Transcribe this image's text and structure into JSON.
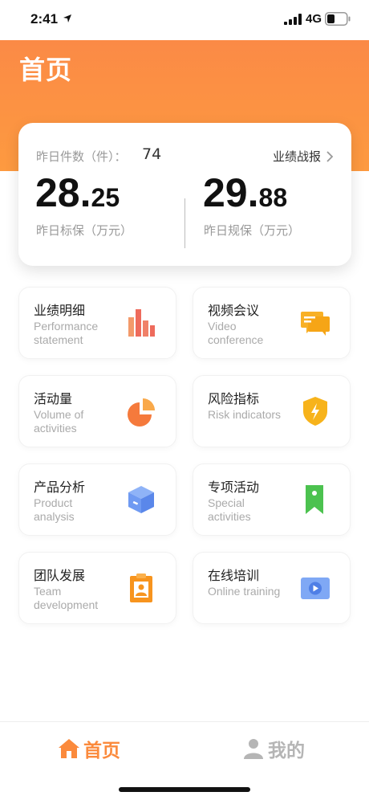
{
  "status_bar": {
    "time": "2:41",
    "network": "4G",
    "icons": [
      "location-arrow-icon",
      "signal-icon",
      "battery-icon"
    ]
  },
  "header": {
    "title": "首页",
    "accent_color": "#fb8a46"
  },
  "summary": {
    "yesterday_count_label": "昨日件数（件）：",
    "yesterday_count_value": "74",
    "performance_link": "业绩战报",
    "left_metric": {
      "int": "28.",
      "dec": "25",
      "label": "昨日标保（万元）"
    },
    "right_metric": {
      "int": "29.",
      "dec": "88",
      "label": "昨日规保（万元）"
    }
  },
  "tiles": [
    {
      "title": "业绩明细",
      "subtitle": "Performance statement",
      "icon": "bar-chart-icon"
    },
    {
      "title": "视频会议",
      "subtitle": "Video conference",
      "icon": "chat-bubble-icon"
    },
    {
      "title": "活动量",
      "subtitle": "Volume of activities",
      "icon": "pie-chart-icon"
    },
    {
      "title": "风险指标",
      "subtitle": "Risk indicators",
      "icon": "shield-icon"
    },
    {
      "title": "产品分析",
      "subtitle": "Product analysis",
      "icon": "cube-icon"
    },
    {
      "title": "专项活动",
      "subtitle": "Special activities",
      "icon": "bookmark-flag-icon"
    },
    {
      "title": "团队发展",
      "subtitle": "Team development",
      "icon": "id-badge-icon"
    },
    {
      "title": "在线培训",
      "subtitle": "Online training",
      "icon": "video-play-icon"
    }
  ],
  "tab_bar": {
    "home_label": "首页",
    "mine_label": "我的",
    "active_color": "#fb8a3c",
    "inactive_color": "#b5b5b5"
  }
}
